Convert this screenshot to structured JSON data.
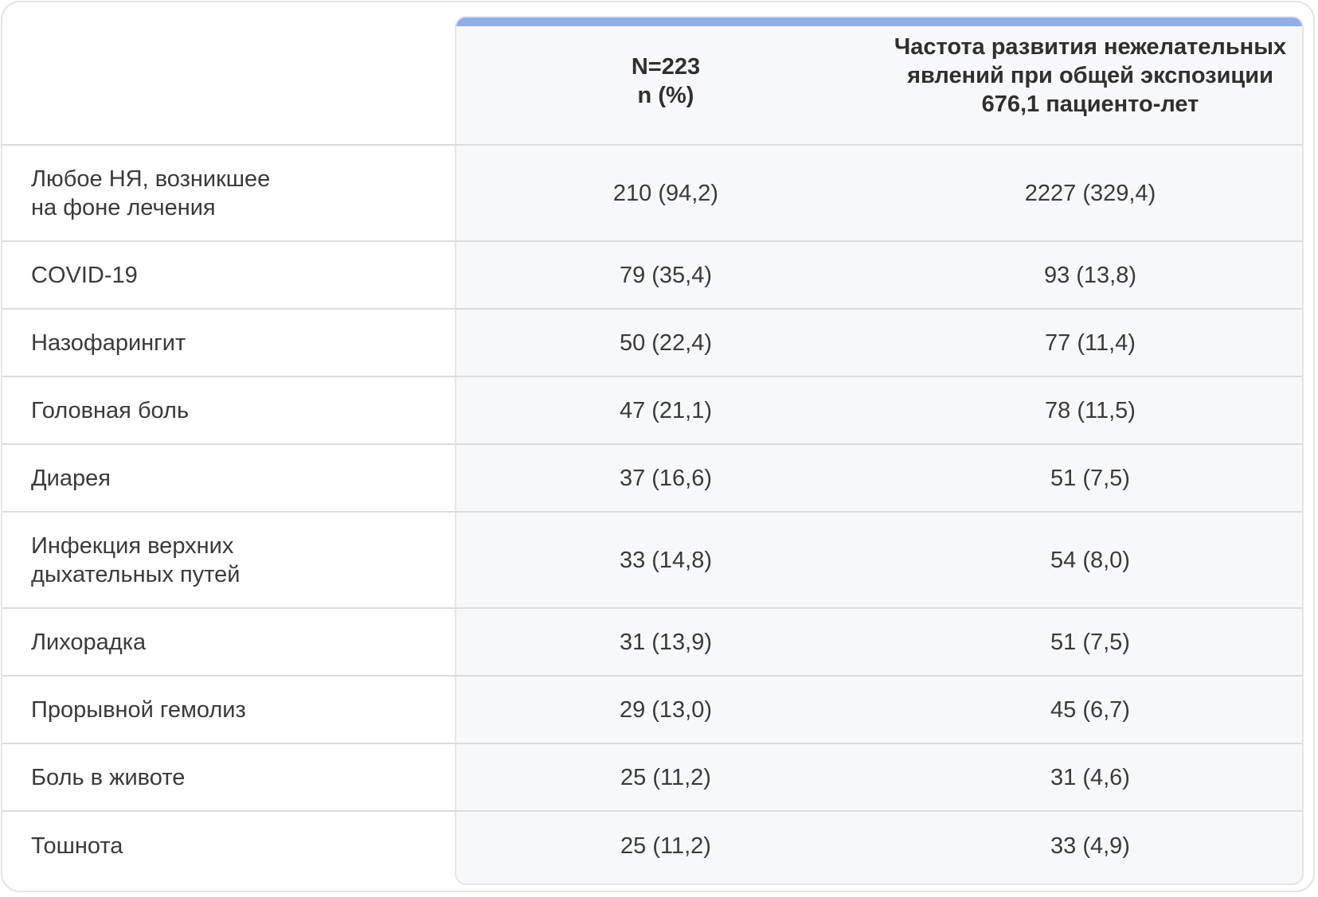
{
  "table": {
    "header": {
      "label": "",
      "n_line1": "N=223",
      "n_line2": "n (%)",
      "rate_line1": "Частота развития нежелательных",
      "rate_line2": "явлений при общей экспозиции",
      "rate_line3": "676,1 пациенто-лет"
    },
    "rows": [
      {
        "label_line1": "Любое НЯ, возникшее",
        "label_line2": "на фоне лечения",
        "n": "210 (94,2)",
        "rate": "2227 (329,4)"
      },
      {
        "label_line1": "COVID-19",
        "n": "79 (35,4)",
        "rate": "93 (13,8)"
      },
      {
        "label_line1": "Назофарингит",
        "n": "50 (22,4)",
        "rate": "77 (11,4)"
      },
      {
        "label_line1": "Головная боль",
        "n": "47 (21,1)",
        "rate": "78 (11,5)"
      },
      {
        "label_line1": "Диарея",
        "n": "37 (16,6)",
        "rate": "51 (7,5)"
      },
      {
        "label_line1": "Инфекция верхних",
        "label_line2": "дыхательных путей",
        "n": "33 (14,8)",
        "rate": "54 (8,0)"
      },
      {
        "label_line1": "Лихорадка",
        "n": "31 (13,9)",
        "rate": "51 (7,5)"
      },
      {
        "label_line1": "Прорывной гемолиз",
        "n": "29 (13,0)",
        "rate": "45 (6,7)"
      },
      {
        "label_line1": "Боль в животе",
        "n": "25 (11,2)",
        "rate": "31 (4,6)"
      },
      {
        "label_line1": "Тошнота",
        "n": "25 (11,2)",
        "rate": "33 (4,9)"
      }
    ]
  }
}
